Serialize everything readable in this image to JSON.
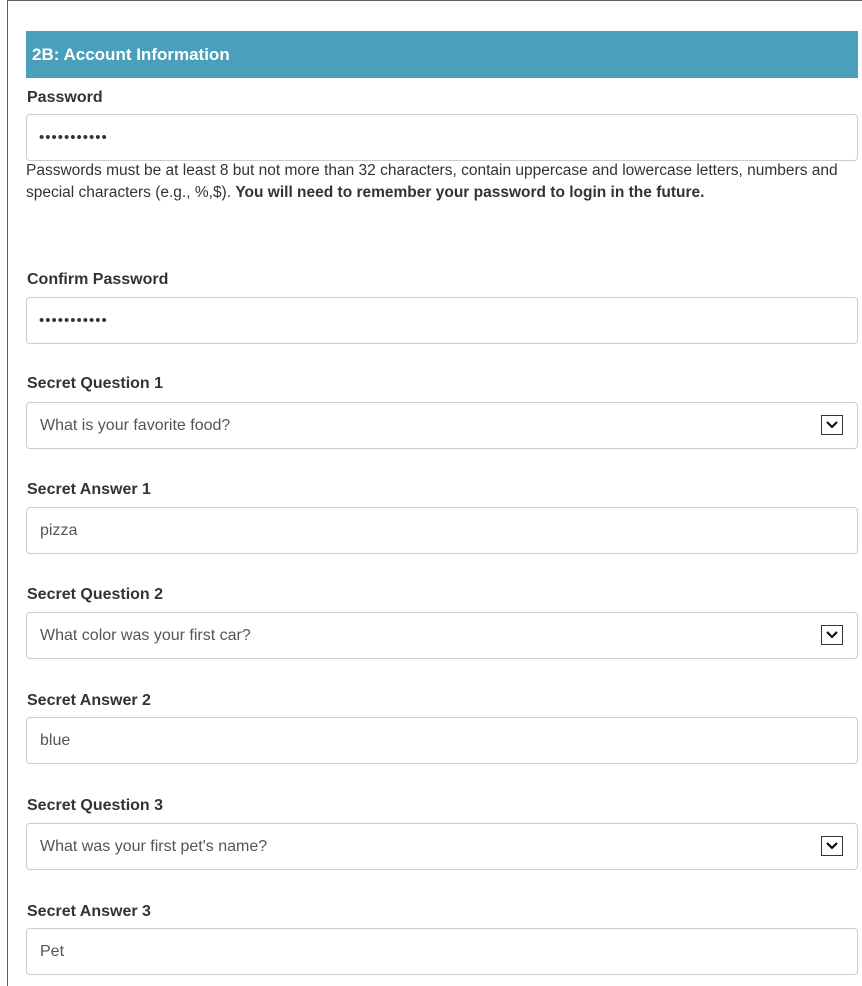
{
  "section": {
    "title": "2B: Account Information"
  },
  "password": {
    "label": "Password",
    "value": "•••••••••••",
    "help_regular": "Passwords must be at least 8 but not more than 32 characters, contain uppercase and lowercase letters, numbers and special characters (e.g., %,$). ",
    "help_bold": "You will need to remember your password to login in the future."
  },
  "confirm_password": {
    "label": "Confirm Password",
    "value": "•••••••••••"
  },
  "secret_question_1": {
    "label": "Secret Question 1",
    "value": "What is your favorite food?"
  },
  "secret_answer_1": {
    "label": "Secret Answer 1",
    "value": "pizza"
  },
  "secret_question_2": {
    "label": "Secret Question 2",
    "value": "What color was your first car?"
  },
  "secret_answer_2": {
    "label": "Secret Answer 2",
    "value": "blue"
  },
  "secret_question_3": {
    "label": "Secret Question 3",
    "value": "What was your first pet's name?"
  },
  "secret_answer_3": {
    "label": "Secret Answer 3",
    "value": "Pet"
  },
  "icons": {
    "dropdown": "chevron-down-icon"
  },
  "colors": {
    "header_bg": "#4aa0ba",
    "header_text": "#ffffff",
    "label": "#333333",
    "border": "#cccccc"
  }
}
